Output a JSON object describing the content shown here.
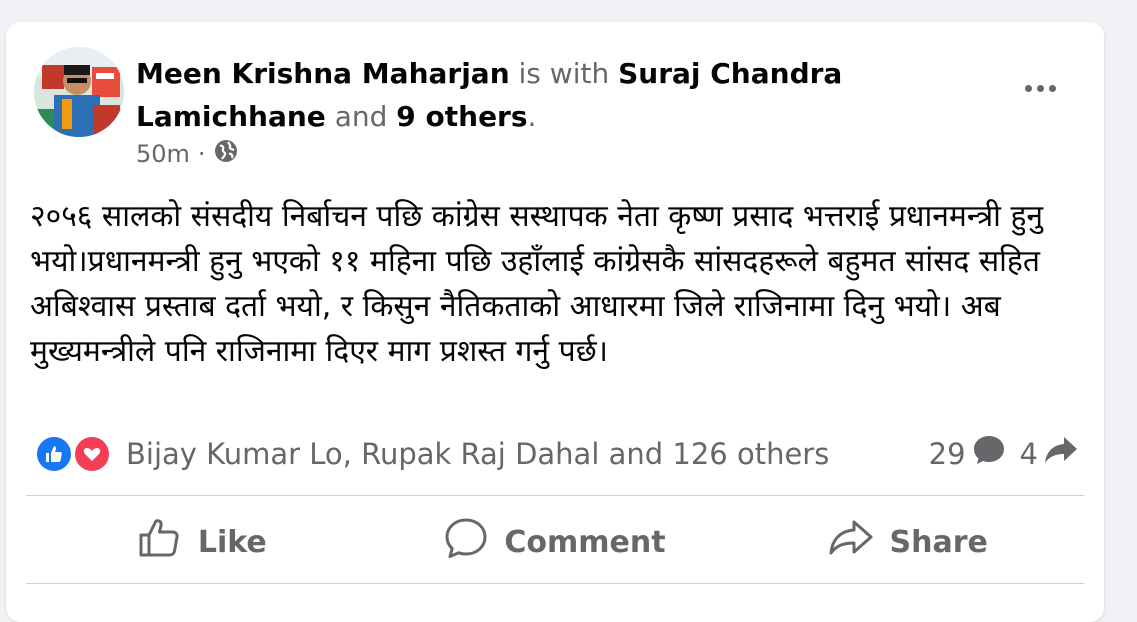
{
  "post": {
    "author": "Meen Krishna Maharjan",
    "with_text": " is with ",
    "tagged": "Suraj Chandra Lamichhane",
    "and_text": " and ",
    "others": "9 others",
    "period": ".",
    "time": "50m",
    "separator": "·",
    "privacy_icon": "globe-icon",
    "text": "२०५६ सालको संसदीय निर्बाचन पछि कांग्रेस सस्थापक नेता कृष्ण प्रसाद भत्तराई प्रधानमन्त्री हुनु भयो।प्रधानमन्त्री हुनु भएको ११ महिना पछि उहाँलाई  कांग्रेसकै सांसदहरूले बहुमत सांसद सहित अबिश्वास प्रस्ताब दर्ता भयो, र किसुन नैतिकताको आधारमा जिले राजिनामा दिनु भयो। अब मुख्यमन्त्रीले पनि राजिनामा  दिएर माग प्रशस्त गर्नु पर्छ।"
  },
  "engagement": {
    "reaction_names": "Bijay Kumar Lo, Rupak Raj Dahal and 126 others",
    "comments": "29",
    "shares": "4"
  },
  "actions": {
    "like": "Like",
    "comment": "Comment",
    "share": "Share"
  },
  "colors": {
    "like_blue": "#1877f2",
    "love_red": "#f33e58",
    "secondary_text": "#65676b"
  }
}
